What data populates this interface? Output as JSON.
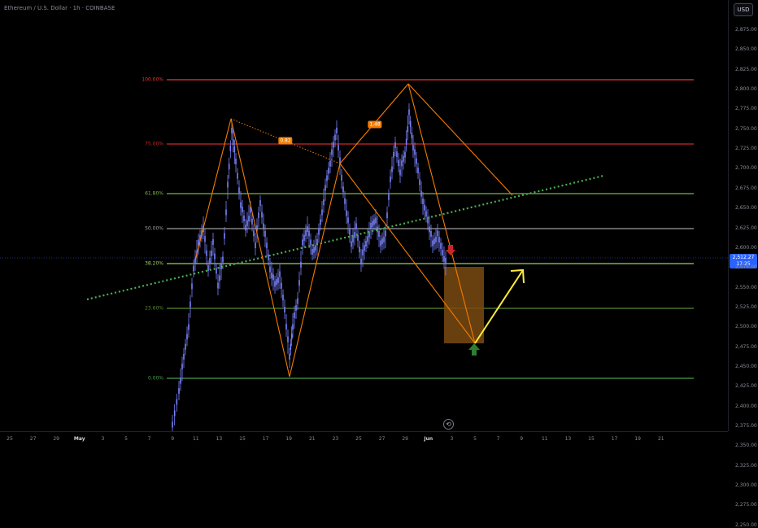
{
  "header": {
    "symbol_title": "Ethereum / U.S. Dollar · 1h · COINBASE",
    "currency": "USD"
  },
  "price_axis": {
    "ticks": [
      "2,875.00",
      "2,850.00",
      "2,825.00",
      "2,800.00",
      "2,775.00",
      "2,750.00",
      "2,725.00",
      "2,700.00",
      "2,675.00",
      "2,650.00",
      "2,625.00",
      "2,600.00",
      "2,575.00",
      "2,550.00",
      "2,525.00",
      "2,500.00",
      "2,475.00",
      "2,450.00",
      "2,425.00",
      "2,400.00",
      "2,375.00",
      "2,350.00",
      "2,325.00",
      "2,300.00",
      "2,275.00",
      "2,250.00"
    ],
    "current_price": "2,512.27",
    "countdown": "17:25"
  },
  "time_axis": {
    "ticks": [
      {
        "label": "25",
        "bold": false
      },
      {
        "label": "27",
        "bold": false
      },
      {
        "label": "29",
        "bold": false
      },
      {
        "label": "May",
        "bold": true
      },
      {
        "label": "3",
        "bold": false
      },
      {
        "label": "5",
        "bold": false
      },
      {
        "label": "7",
        "bold": false
      },
      {
        "label": "9",
        "bold": false
      },
      {
        "label": "11",
        "bold": false
      },
      {
        "label": "13",
        "bold": false
      },
      {
        "label": "15",
        "bold": false
      },
      {
        "label": "17",
        "bold": false
      },
      {
        "label": "19",
        "bold": false
      },
      {
        "label": "21",
        "bold": false
      },
      {
        "label": "23",
        "bold": false
      },
      {
        "label": "25",
        "bold": false
      },
      {
        "label": "27",
        "bold": false
      },
      {
        "label": "29",
        "bold": false
      },
      {
        "label": "Jun",
        "bold": true
      },
      {
        "label": "3",
        "bold": false
      },
      {
        "label": "5",
        "bold": false
      },
      {
        "label": "7",
        "bold": false
      },
      {
        "label": "9",
        "bold": false
      },
      {
        "label": "11",
        "bold": false
      },
      {
        "label": "13",
        "bold": false
      },
      {
        "label": "15",
        "bold": false
      },
      {
        "label": "17",
        "bold": false
      },
      {
        "label": "19",
        "bold": false
      },
      {
        "label": "21",
        "bold": false
      }
    ]
  },
  "fib_levels": [
    {
      "label": "100.00%",
      "color": "#e53935"
    },
    {
      "label": "75.00%",
      "color": "#c62828"
    },
    {
      "label": "61.80%",
      "color": "#7cb342"
    },
    {
      "label": "50.00%",
      "color": "#9e9e9e"
    },
    {
      "label": "38.20%",
      "color": "#9ccc65"
    },
    {
      "label": "23.60%",
      "color": "#558b2f"
    },
    {
      "label": "0.00%",
      "color": "#43a047"
    }
  ],
  "pattern": {
    "ratio_left": "0.82",
    "ratio_right": "1.48",
    "line_color": "#f57c00"
  },
  "colors": {
    "candles": "#7b83ff",
    "trend_dotted": "#4caf50",
    "projection": "#ffeb3b",
    "target_box": "#7a4a10",
    "arrow_down": "#c62828",
    "arrow_up": "#2e7d32",
    "price_line": "#2962ff"
  },
  "icons": {
    "replay": "replay-icon"
  }
}
